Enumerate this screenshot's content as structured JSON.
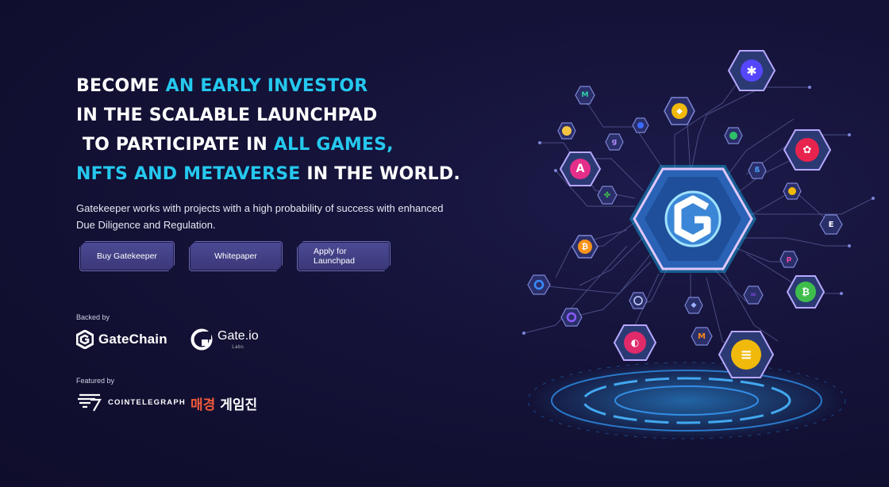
{
  "headline": {
    "line1": {
      "plain": "BECOME ",
      "accent": "AN EARLY INVESTOR"
    },
    "line2": {
      "plain": "IN THE SCALABLE LAUNCHPAD"
    },
    "line3": {
      "plain": " TO PARTICIPATE IN ",
      "accent": "ALL GAMES,"
    },
    "line4": {
      "accent": "NFTS AND METAVERSE",
      "plain": " IN THE WORLD."
    }
  },
  "description": "Gatekeeper works with projects with a high probability of success with enhanced Due Diligence and Regulation.",
  "buttons": {
    "buy": "Buy Gatekeeper",
    "whitepaper": "Whitepaper",
    "apply": "Apply for Launchpad"
  },
  "backed": {
    "label": "Backed by",
    "gatechain": "GateChain",
    "gateio": "Gate.io",
    "gateio_sub": "Labs"
  },
  "featured": {
    "label": "Featured by",
    "cointelegraph": "COINTELEGRAPH",
    "maekyung_red": "매경",
    "maekyung_white": "게임진"
  },
  "colors": {
    "accent": "#25c8ee",
    "background": "#141237",
    "button": "#3f3d80"
  },
  "icons": [
    "gatekeeper-logo-icon",
    "stacks-icon",
    "binance-icon",
    "amp-icon",
    "coin98-icon",
    "bitcoin-icon",
    "bitcoin-cash-icon",
    "mask-icon",
    "elrond-icon",
    "busd-icon",
    "metamask-icon",
    "ethereum-icon",
    "polygon-icon"
  ]
}
